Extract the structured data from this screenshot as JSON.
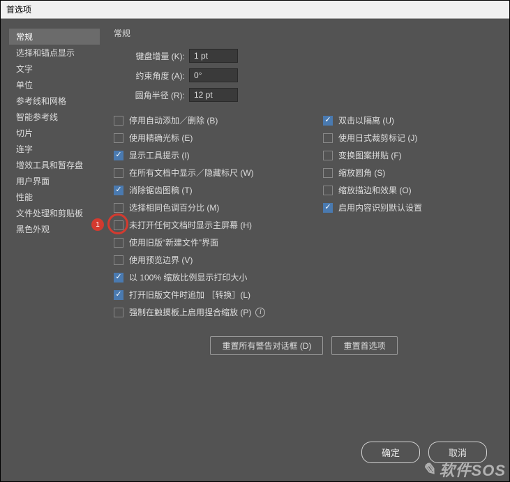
{
  "window": {
    "title": "首选项"
  },
  "sidebar": {
    "items": [
      {
        "label": "常规",
        "active": true
      },
      {
        "label": "选择和锚点显示"
      },
      {
        "label": "文字"
      },
      {
        "label": "单位"
      },
      {
        "label": "参考线和网格"
      },
      {
        "label": "智能参考线"
      },
      {
        "label": "切片"
      },
      {
        "label": "连字"
      },
      {
        "label": "增效工具和暂存盘"
      },
      {
        "label": "用户界面"
      },
      {
        "label": "性能"
      },
      {
        "label": "文件处理和剪贴板"
      },
      {
        "label": "黑色外观"
      }
    ]
  },
  "section": {
    "title": "常规"
  },
  "fields": {
    "keyboard_increment": {
      "label": "键盘增量 (K):",
      "value": "1 pt"
    },
    "constrain_angle": {
      "label": "约束角度 (A):",
      "value": "0°"
    },
    "corner_radius": {
      "label": "圆角半径 (R):",
      "value": "12 pt"
    }
  },
  "checks_left": [
    {
      "label": "停用自动添加／删除 (B)",
      "checked": false
    },
    {
      "label": "使用精确光标 (E)",
      "checked": false
    },
    {
      "label": "显示工具提示 (I)",
      "checked": true
    },
    {
      "label": "在所有文档中显示／隐藏标尺 (W)",
      "checked": false
    },
    {
      "label": "消除锯齿图稿 (T)",
      "checked": true
    },
    {
      "label": "选择相同色调百分比 (M)",
      "checked": false
    },
    {
      "label": "未打开任何文档时显示主屏幕 (H)",
      "checked": false,
      "annotated": true,
      "ann_num": "1"
    },
    {
      "label": "使用旧版“新建文件”界面",
      "checked": false
    },
    {
      "label": "使用预览边界 (V)",
      "checked": false
    },
    {
      "label": "以 100% 缩放比例显示打印大小",
      "checked": true
    },
    {
      "label": "打开旧版文件时追加 ［转换］(L)",
      "checked": true
    },
    {
      "label": "强制在触摸板上启用捏合缩放 (P)",
      "checked": false,
      "info": true
    }
  ],
  "checks_right": [
    {
      "label": "双击以隔离 (U)",
      "checked": true
    },
    {
      "label": "使用日式裁剪标记 (J)",
      "checked": false
    },
    {
      "label": "变换图案拼贴 (F)",
      "checked": false
    },
    {
      "label": "缩放圆角 (S)",
      "checked": false
    },
    {
      "label": "缩放描边和效果 (O)",
      "checked": false
    },
    {
      "label": "启用内容识别默认设置",
      "checked": true
    }
  ],
  "buttons": {
    "reset_warnings": "重置所有警告对话框 (D)",
    "reset_prefs": "重置首选项",
    "ok": "确定",
    "cancel": "取消"
  },
  "watermark": {
    "text": "软件SOS"
  }
}
